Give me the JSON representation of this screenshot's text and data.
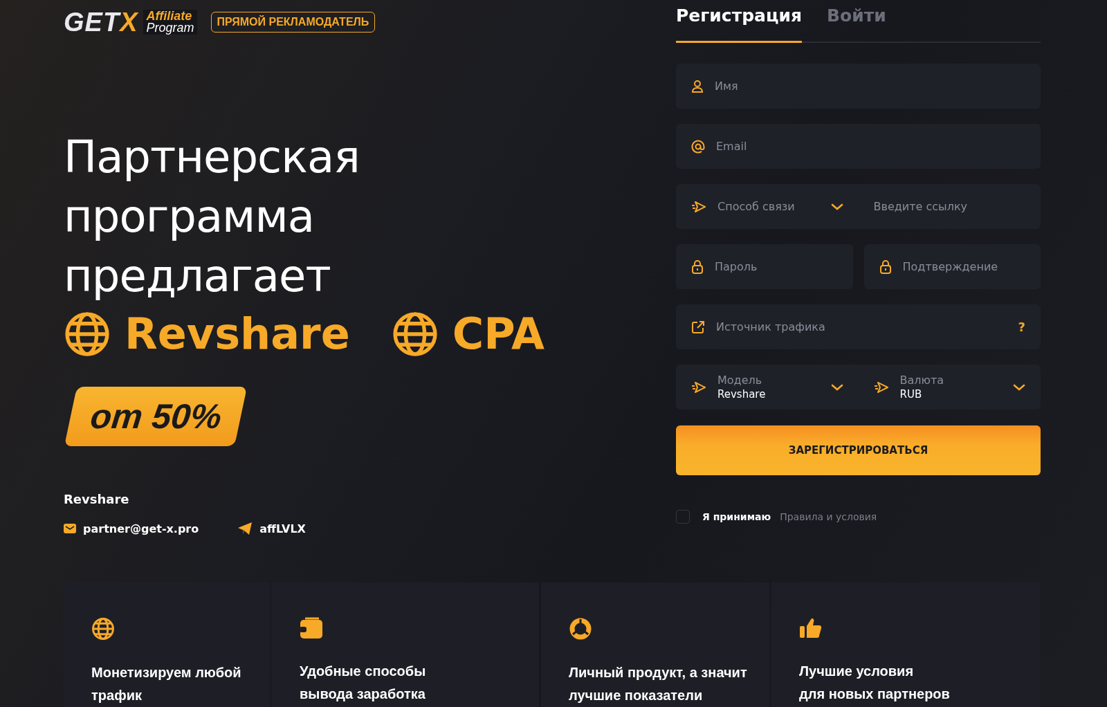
{
  "header": {
    "logo": {
      "brand": "GET",
      "accent": "X",
      "tagline": [
        "Affiliate",
        "Program"
      ]
    },
    "badge": "ПРЯМОЙ РЕКЛАМОДАТЕЛЬ"
  },
  "hero": {
    "title": [
      "Партнерская",
      "программа",
      "предлагает"
    ],
    "models": [
      "Revshare",
      "CPA"
    ],
    "promo": "от 50%",
    "contact_heading": "Revshare",
    "contacts": [
      {
        "kind": "email",
        "text": "partner@get-x.pro"
      },
      {
        "kind": "telegram",
        "text": "affLVLX"
      }
    ]
  },
  "form": {
    "tabs": [
      {
        "label": "Регистрация",
        "selected": true
      },
      {
        "label": "Войти",
        "selected": false
      }
    ],
    "rows": [
      {
        "fields": [
          {
            "kind": "name",
            "placeholder": "Имя"
          }
        ]
      },
      {
        "fields": [
          {
            "kind": "email",
            "placeholder": "Email"
          }
        ]
      },
      {
        "joined": true,
        "fields": [
          {
            "kind": "select",
            "placeholder": "Способ связи"
          },
          {
            "kind": "url",
            "placeholder": "Введите ссылку"
          }
        ]
      },
      {
        "joined": false,
        "fields": [
          {
            "kind": "password",
            "placeholder": "Пароль"
          },
          {
            "kind": "password",
            "placeholder": "Подтверждение"
          }
        ]
      },
      {
        "fields": [
          {
            "kind": "source",
            "placeholder": "Источник трафика",
            "help": "?"
          }
        ]
      },
      {
        "joined": true,
        "fields": [
          {
            "kind": "labeled-select",
            "label": "Модель",
            "value": "Revshare"
          },
          {
            "kind": "labeled-select",
            "label": "Валюта",
            "value": "RUB"
          }
        ]
      }
    ],
    "submit": "ЗАРЕГИСТРИРОВАТЬСЯ",
    "terms": {
      "checked": false,
      "label": "Я принимаю",
      "link": "Правила и условия"
    }
  },
  "features": [
    {
      "kind": "globe",
      "lines": [
        "Монетизируем любой",
        "трафик"
      ]
    },
    {
      "kind": "wallet",
      "lines": [
        "Удобные способы",
        "вывода заработка"
      ]
    },
    {
      "kind": "chart",
      "lines": [
        "Личный продукт, а значит",
        "лучшие показатели"
      ]
    },
    {
      "kind": "thumb",
      "lines": [
        "Лучшие условия",
        "для новых партнеров"
      ]
    }
  ]
}
